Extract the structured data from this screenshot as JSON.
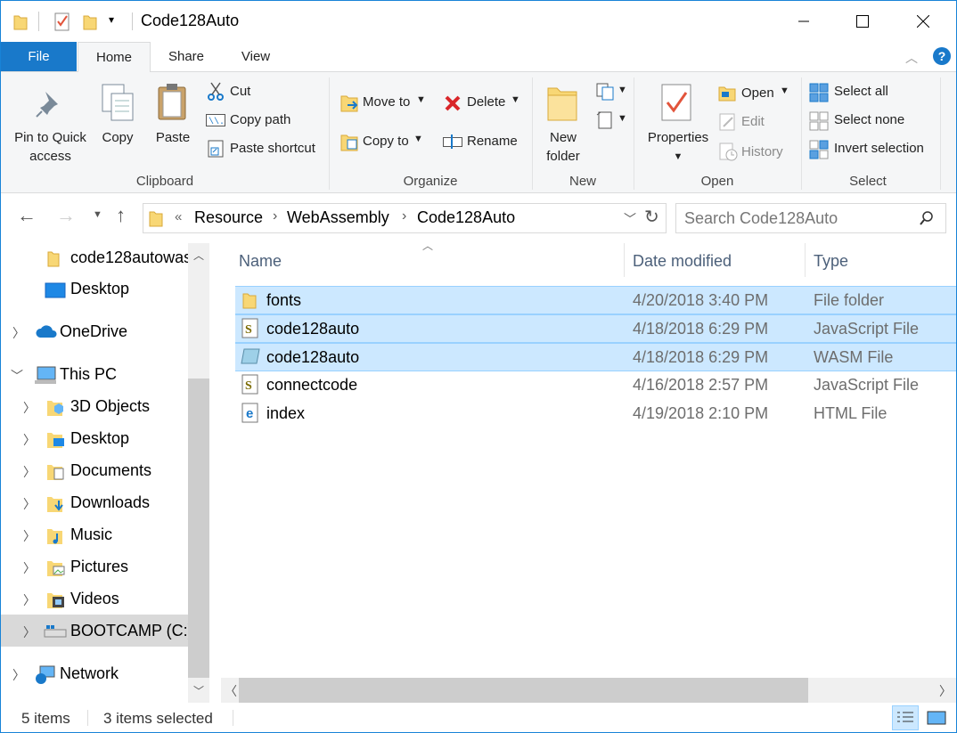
{
  "window": {
    "title": "Code128Auto"
  },
  "tabs": [
    {
      "label": "File"
    },
    {
      "label": "Home"
    },
    {
      "label": "Share"
    },
    {
      "label": "View"
    }
  ],
  "clipboard": {
    "group_label": "Clipboard",
    "pin_line1": "Pin to Quick",
    "pin_line2": "access",
    "copy": "Copy",
    "paste": "Paste",
    "cut": "Cut",
    "copy_path": "Copy path",
    "paste_shortcut": "Paste shortcut"
  },
  "organize": {
    "group_label": "Organize",
    "move_to": "Move to",
    "copy_to": "Copy to",
    "delete": "Delete",
    "rename": "Rename"
  },
  "new": {
    "group_label": "New",
    "new_line1": "New",
    "new_line2": "folder"
  },
  "open": {
    "group_label": "Open",
    "properties": "Properties",
    "open": "Open",
    "edit": "Edit",
    "history": "History"
  },
  "select": {
    "group_label": "Select",
    "select_all": "Select all",
    "select_none": "Select none",
    "invert": "Invert selection"
  },
  "address": {
    "overflow": "«",
    "crumbs": [
      "Resource",
      "WebAssembly",
      "Code128Auto"
    ],
    "search_placeholder": "Search Code128Auto"
  },
  "nav": {
    "items": [
      {
        "label": "code128autowas"
      },
      {
        "label": "Desktop"
      },
      {
        "label": "OneDrive"
      },
      {
        "label": "This PC"
      },
      {
        "label": "3D Objects"
      },
      {
        "label": "Desktop"
      },
      {
        "label": "Documents"
      },
      {
        "label": "Downloads"
      },
      {
        "label": "Music"
      },
      {
        "label": "Pictures"
      },
      {
        "label": "Videos"
      },
      {
        "label": "BOOTCAMP (C:)"
      },
      {
        "label": "Network"
      }
    ]
  },
  "list": {
    "columns": {
      "name": "Name",
      "date": "Date modified",
      "type": "Type"
    },
    "rows": [
      {
        "name": "fonts",
        "date": "4/20/2018 3:40 PM",
        "type": "File folder",
        "selected": true,
        "icon": "folder-icon"
      },
      {
        "name": "code128auto",
        "date": "4/18/2018 6:29 PM",
        "type": "JavaScript File",
        "selected": true,
        "icon": "javascript-file-icon"
      },
      {
        "name": "code128auto",
        "date": "4/18/2018 6:29 PM",
        "type": "WASM File",
        "selected": true,
        "icon": "wasm-file-icon"
      },
      {
        "name": "connectcode",
        "date": "4/16/2018 2:57 PM",
        "type": "JavaScript File",
        "selected": false,
        "icon": "javascript-file-icon"
      },
      {
        "name": "index",
        "date": "4/19/2018 2:10 PM",
        "type": "HTML File",
        "selected": false,
        "icon": "html-file-icon"
      }
    ]
  },
  "status": {
    "items": "5 items",
    "selected": "3 items selected"
  },
  "colors": {
    "accent": "#1979ca",
    "selection": "#cce8ff",
    "folder": "#f8d775"
  }
}
